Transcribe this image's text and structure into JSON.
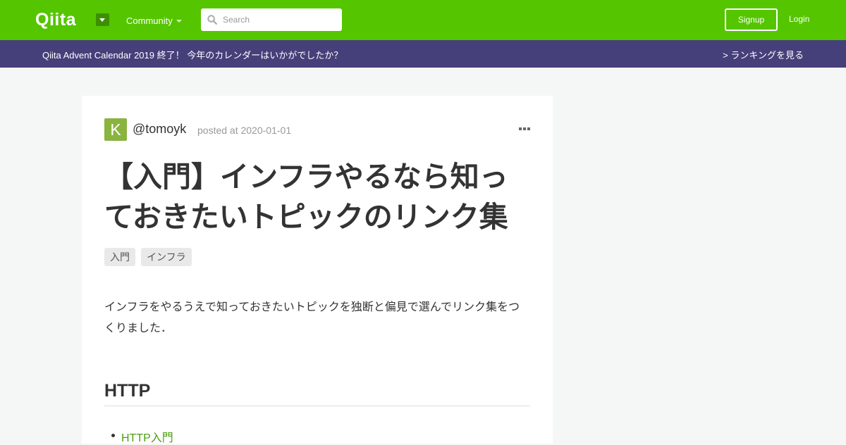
{
  "header": {
    "logo": "Qiita",
    "community_label": "Community",
    "search_placeholder": "Search",
    "signup_label": "Signup",
    "login_label": "Login",
    "icons": [
      "chevron-down-icon",
      "search-icon"
    ]
  },
  "banner": {
    "text": "Qiita Advent Calendar 2019 終了！ 今年のカレンダーはいかがでしたか？",
    "link": "> ランキングを見る"
  },
  "article": {
    "avatar_letter": "K",
    "author": "@tomoyk",
    "posted": "posted at 2020-01-01",
    "title": "【入門】インフラやるなら知っておきたいトピックのリンク集",
    "tags": [
      "入門",
      "インフラ"
    ],
    "intro": "インフラをやるうえで知っておきたいトピックを独断と偏見で選んでリンク集をつくりました．",
    "section_heading": "HTTP",
    "links": [
      "HTTP入門"
    ]
  },
  "colors": {
    "header_green": "#55c500",
    "banner_purple": "#453f7a",
    "link_green": "#4d9d12",
    "avatar_green": "#8ab340"
  }
}
